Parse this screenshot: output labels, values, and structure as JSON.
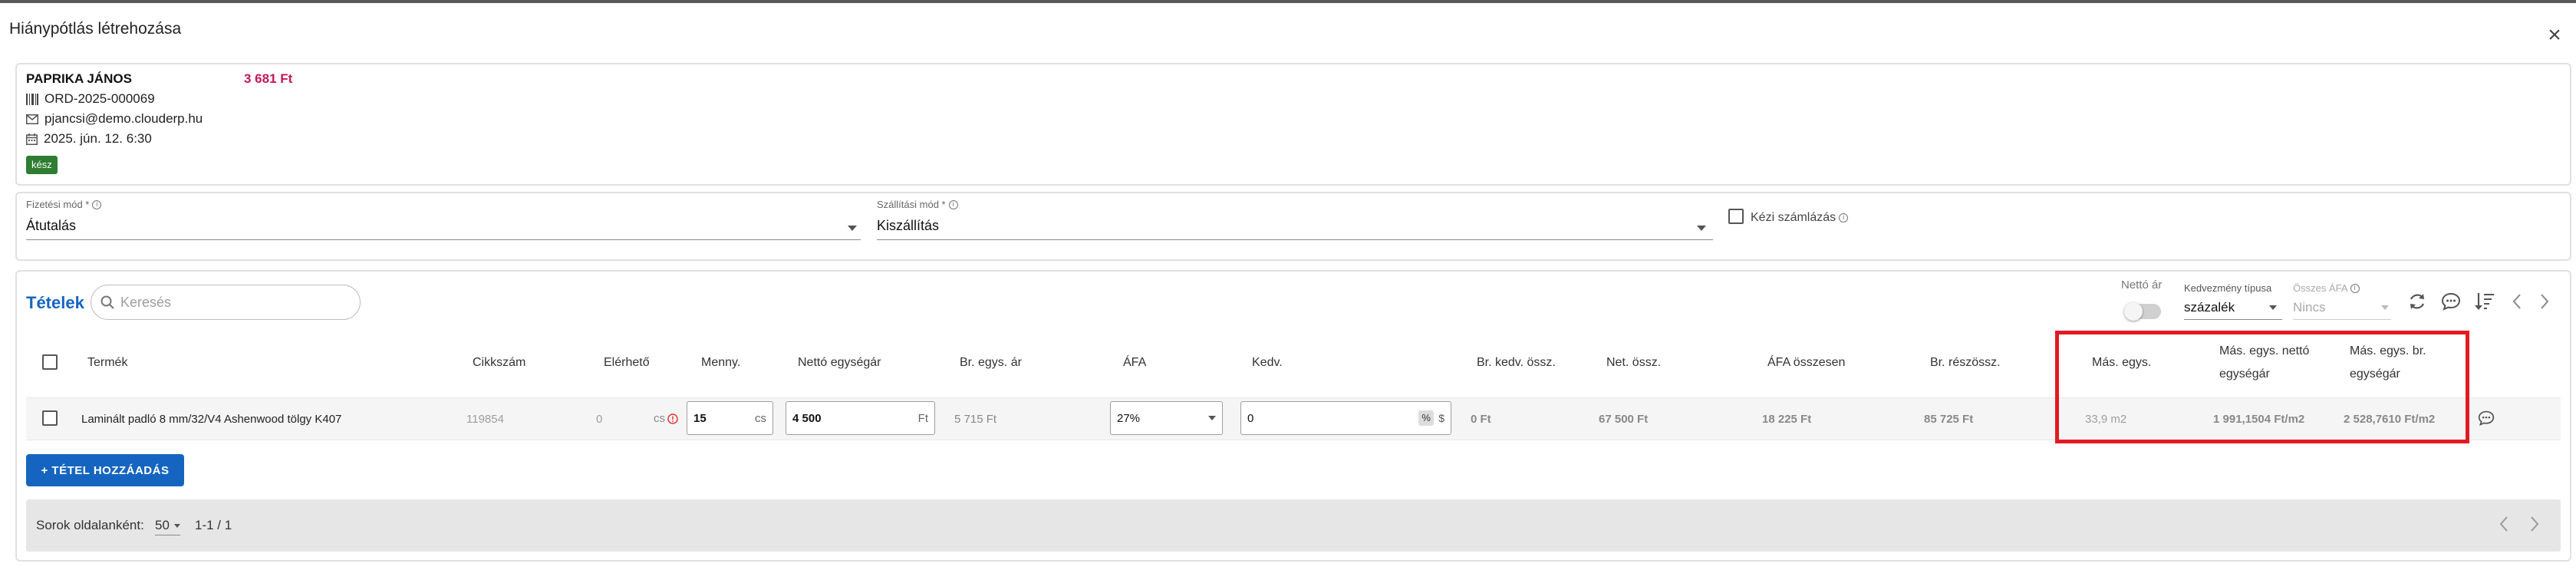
{
  "dialog": {
    "title": "Hiánypótlás létrehozása",
    "close_icon": "close-icon"
  },
  "customer": {
    "name": "PAPRIKA JÁNOS",
    "amount": "3 681 Ft",
    "order_id": "ORD-2025-000069",
    "email": "pjancsi@demo.clouderp.hu",
    "date": "2025. jún. 12. 6:30",
    "status": "kész",
    "status_color": "#2e7d32",
    "amount_color": "#c2185b"
  },
  "options": {
    "payment_label": "Fizetési mód *",
    "payment_value": "Átutalás",
    "shipping_label": "Szállítási mód *",
    "shipping_value": "Kiszállítás",
    "manual_invoice_label": "Kézi számlázás"
  },
  "items": {
    "title": "Tételek",
    "search_placeholder": "Keresés",
    "net_price_toggle_label": "Nettó ár",
    "discount_type_label": "Kedvezmény típusa",
    "discount_type_value": "százalék",
    "total_vat_label": "Összes ÁFA",
    "total_vat_value": "Nincs",
    "columns": {
      "product": "Termék",
      "sku": "Cikkszám",
      "available": "Elérhető",
      "qty": "Menny.",
      "net_unit_price": "Nettó egységár",
      "gross_unit_price": "Br. egys. ár",
      "vat": "ÁFA",
      "discount": "Kedv.",
      "gross_discount_total": "Br. kedv. össz.",
      "net_total": "Net. össz.",
      "vat_total": "ÁFA összesen",
      "gross_subtotal": "Br. részössz.",
      "alt_unit": "Más. egys.",
      "alt_unit_net_price_1": "Más. egys. nettó",
      "alt_unit_net_price_2": "egységár",
      "alt_unit_gross_price_1": "Más. egys. br.",
      "alt_unit_gross_price_2": "egységár"
    },
    "rows": [
      {
        "product": "Laminált padló 8 mm/32/V4 Ashenwood tölgy K407",
        "sku": "119854",
        "available": "0",
        "available_unit": "cs",
        "qty": "15",
        "qty_unit": "cs",
        "net_unit_price": "4 500",
        "net_unit_price_currency": "Ft",
        "gross_unit_price": "5 715 Ft",
        "vat": "27%",
        "discount": "0",
        "discount_percent_symbol": "%",
        "discount_currency_symbol": "$",
        "gross_discount_total": "0 Ft",
        "net_total": "67 500 Ft",
        "vat_total": "18 225 Ft",
        "gross_subtotal": "85 725 Ft",
        "alt_unit": "33,9 m2",
        "alt_unit_net_price": "1 991,1504 Ft/m2",
        "alt_unit_gross_price": "2 528,7610 Ft/m2"
      }
    ],
    "add_button_label": "+ TÉTEL HOZZÁADÁS"
  },
  "pagination": {
    "rows_per_page_label": "Sorok oldalanként:",
    "rows_per_page_value": "50",
    "range": "1-1 / 1"
  },
  "highlight_color": "#e11b22"
}
